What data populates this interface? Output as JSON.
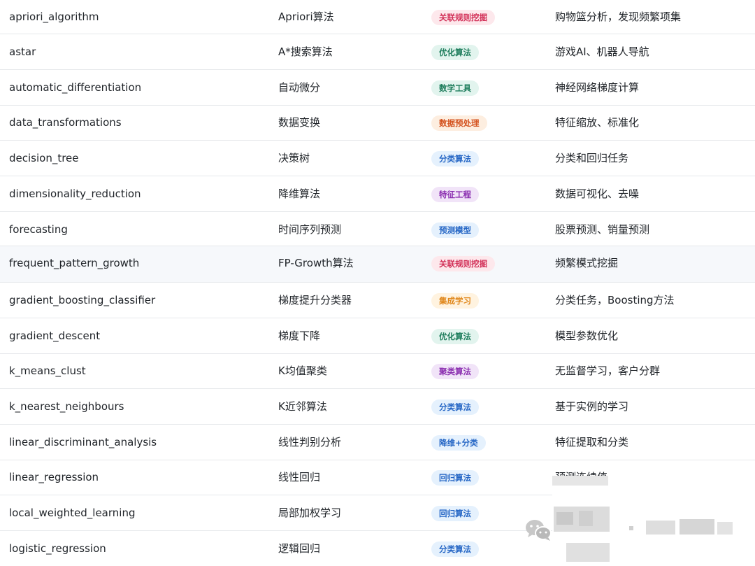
{
  "colors": {
    "red": "#d22f57",
    "green": "#1e7d5c",
    "orange": "#d4531f",
    "blue": "#2566c5",
    "purple": "#8b2fb0",
    "gold": "#e0871b",
    "highlight_row": "#f6f8fb"
  },
  "rows": [
    {
      "name": "apriori_algorithm",
      "cn": "Apriori算法",
      "category": "关联规则挖掘",
      "tone": "red",
      "app": "购物篮分析，发现频繁项集"
    },
    {
      "name": "astar",
      "cn": "A*搜索算法",
      "category": "优化算法",
      "tone": "green",
      "app": "游戏AI、机器人导航"
    },
    {
      "name": "automatic_differentiation",
      "cn": "自动微分",
      "category": "数学工具",
      "tone": "green",
      "app": "神经网络梯度计算"
    },
    {
      "name": "data_transformations",
      "cn": "数据变换",
      "category": "数据预处理",
      "tone": "orange",
      "app": "特征缩放、标准化"
    },
    {
      "name": "decision_tree",
      "cn": "决策树",
      "category": "分类算法",
      "tone": "blue",
      "app": "分类和回归任务"
    },
    {
      "name": "dimensionality_reduction",
      "cn": "降维算法",
      "category": "特征工程",
      "tone": "purple",
      "app": "数据可视化、去噪"
    },
    {
      "name": "forecasting",
      "cn": "时间序列预测",
      "category": "预测模型",
      "tone": "blue",
      "app": "股票预测、销量预测"
    },
    {
      "name": "frequent_pattern_growth",
      "cn": "FP-Growth算法",
      "category": "关联规则挖掘",
      "tone": "red",
      "app": "频繁模式挖掘"
    },
    {
      "name": "gradient_boosting_classifier",
      "cn": "梯度提升分类器",
      "category": "集成学习",
      "tone": "gold",
      "app": "分类任务，Boosting方法"
    },
    {
      "name": "gradient_descent",
      "cn": "梯度下降",
      "category": "优化算法",
      "tone": "green",
      "app": "模型参数优化"
    },
    {
      "name": "k_means_clust",
      "cn": "K均值聚类",
      "category": "聚类算法",
      "tone": "purple",
      "app": "无监督学习，客户分群"
    },
    {
      "name": "k_nearest_neighbours",
      "cn": "K近邻算法",
      "category": "分类算法",
      "tone": "blue",
      "app": "基于实例的学习"
    },
    {
      "name": "linear_discriminant_analysis",
      "cn": "线性判别分析",
      "category": "降维+分类",
      "tone": "blue",
      "app": "特征提取和分类"
    },
    {
      "name": "linear_regression",
      "cn": "线性回归",
      "category": "回归算法",
      "tone": "blue",
      "app": "预测连续值"
    },
    {
      "name": "local_weighted_learning",
      "cn": "局部加权学习",
      "category": "回归算法",
      "tone": "blue",
      "app": ""
    },
    {
      "name": "logistic_regression",
      "cn": "逻辑回归",
      "category": "分类算法",
      "tone": "blue",
      "app": ""
    }
  ],
  "watermark": {
    "icon": "wechat-icon"
  }
}
